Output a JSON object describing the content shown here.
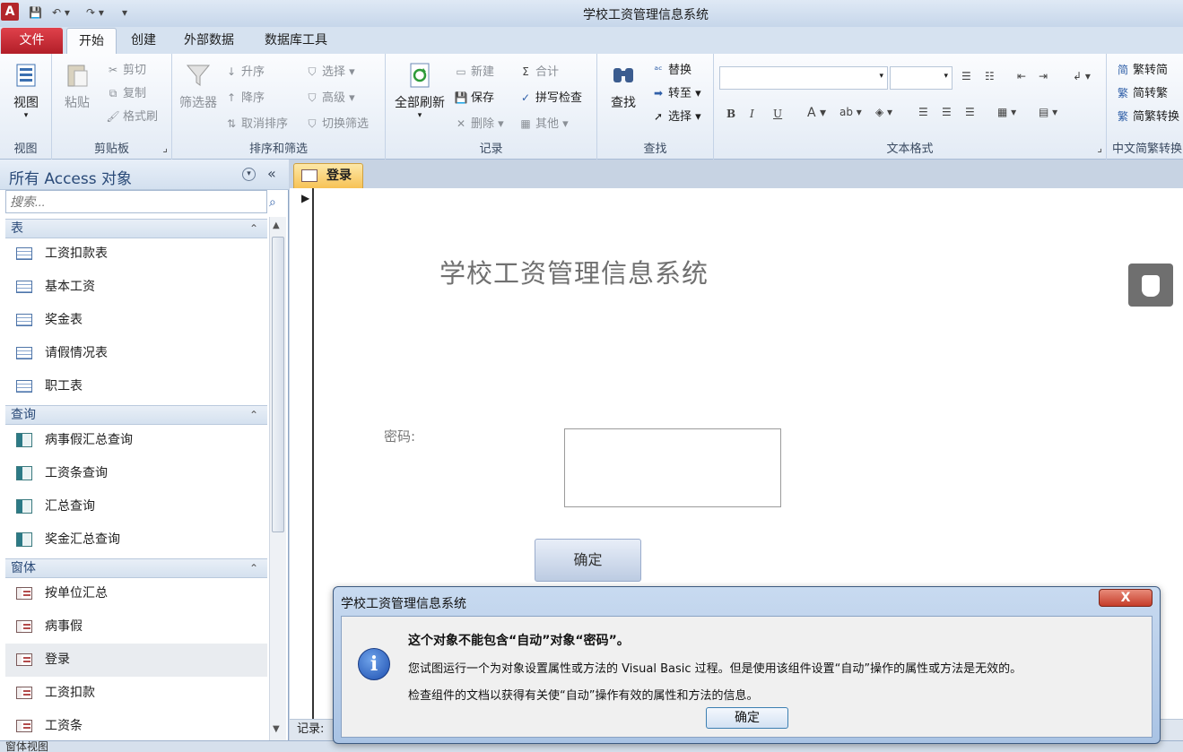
{
  "window": {
    "title": "学校工资管理信息系统",
    "app_logo": "A"
  },
  "quick_access": [
    "save-icon",
    "undo-icon",
    "redo-icon",
    "customize-icon"
  ],
  "tabs": [
    {
      "label": "文件",
      "active": false
    },
    {
      "label": "开始",
      "active": true
    },
    {
      "label": "创建",
      "active": false
    },
    {
      "label": "外部数据",
      "active": false
    },
    {
      "label": "数据库工具",
      "active": false
    }
  ],
  "ribbon": {
    "view": {
      "button": "视图",
      "group": "视图"
    },
    "clipboard": {
      "paste": "粘贴",
      "cut": "剪切",
      "copy": "复制",
      "format_painter": "格式刷",
      "group": "剪贴板"
    },
    "sort_filter": {
      "filter": "筛选器",
      "asc": "升序",
      "desc": "降序",
      "clear_sort": "取消排序",
      "selection": "选择",
      "advanced": "高级",
      "toggle_filter": "切换筛选",
      "group": "排序和筛选"
    },
    "records": {
      "refresh_all": "全部刷新",
      "new": "新建",
      "save": "保存",
      "delete": "删除",
      "totals": "合计",
      "spelling": "拼写检查",
      "more": "其他",
      "group": "记录"
    },
    "find": {
      "find": "查找",
      "replace": "替换",
      "goto": "转至",
      "select": "选择",
      "group": "查找"
    },
    "text_format": {
      "group": "文本格式",
      "bold": "B",
      "italic": "I",
      "underline": "U",
      "font_color": "A"
    },
    "chinese": {
      "to_simplified": "繁转简",
      "to_traditional": "简转繁",
      "convert": "简繁转换",
      "group": "中文简繁转换"
    }
  },
  "nav": {
    "title": "所有 Access 对象",
    "search_placeholder": "搜索...",
    "sections": [
      {
        "label": "表",
        "items": [
          "工资扣款表",
          "基本工资",
          "奖金表",
          "请假情况表",
          "职工表"
        ]
      },
      {
        "label": "查询",
        "items": [
          "病事假汇总查询",
          "工资条查询",
          "汇总查询",
          "奖金汇总查询"
        ]
      },
      {
        "label": "窗体",
        "items": [
          "按单位汇总",
          "病事假",
          "登录",
          "工资扣款",
          "工资条"
        ]
      }
    ]
  },
  "document": {
    "tab_label": "登录",
    "form_title": "学校工资管理信息系统",
    "password_label": "密码:",
    "ok_button": "确定",
    "record_label": "记录:"
  },
  "status": {
    "text": "窗体视图"
  },
  "dialog": {
    "title": "学校工资管理信息系统",
    "close": "X",
    "heading": "这个对象不能包含“自动”对象“密码”。",
    "line2": "您试图运行一个为对象设置属性或方法的 Visual Basic 过程。但是使用该组件设置“自动”操作的属性或方法是无效的。",
    "line3": "检查组件的文档以获得有关使“自动”操作有效的属性和方法的信息。",
    "ok": "确定",
    "icon": "info-icon"
  }
}
